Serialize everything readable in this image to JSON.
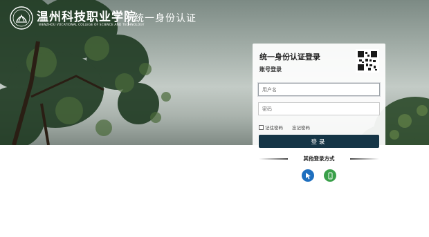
{
  "header": {
    "school_name_cn": "温州科技职业学院",
    "school_name_en": "WENZHOU VOCATIONAL COLLEGE OF SCIENCE AND TECHNOLOGY",
    "system_title": "统一身份认证"
  },
  "login": {
    "title": "统一身份认证登录",
    "subtitle": "账号登录",
    "username_placeholder": "用户名",
    "password_placeholder": "密码",
    "remember_label": "记住密码",
    "forgot_label": "忘记密码",
    "submit_label": "登录",
    "qr_icon": "qr-code-icon"
  },
  "other_login": {
    "label": "其他登录方式",
    "methods": [
      {
        "icon": "pointer-icon",
        "color": "#1e6fbf"
      },
      {
        "icon": "mobile-phone-icon",
        "color": "#3aa04a"
      }
    ]
  },
  "colors": {
    "button": "#153546",
    "card": "#ffffff"
  }
}
